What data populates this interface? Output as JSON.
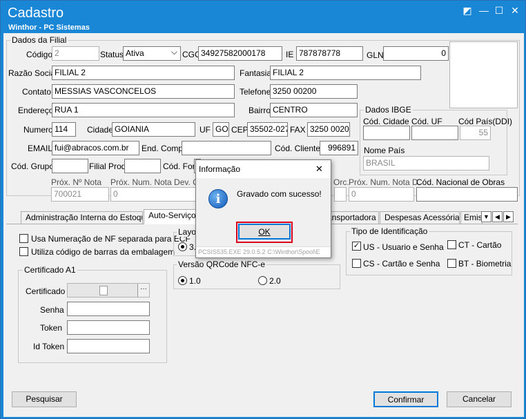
{
  "window": {
    "title": "Cadastro",
    "subtitle": "Winthor - PC Sistemas"
  },
  "dados_filial": {
    "group_title": "Dados da Filial",
    "codigo": {
      "label": "Código",
      "value": "2"
    },
    "status": {
      "label": "Status",
      "value": "Ativa"
    },
    "cgc": {
      "label": "CGC",
      "value": "34927582000178"
    },
    "ie": {
      "label": "IE",
      "value": "787878778"
    },
    "gln": {
      "label": "GLN",
      "value": "0"
    },
    "razao_social": {
      "label": "Razão Social",
      "value": "FILIAL 2"
    },
    "fantasia": {
      "label": "Fantasia",
      "value": "FILIAL 2"
    },
    "contato": {
      "label": "Contato",
      "value": "MESSIAS VASCONCELOS"
    },
    "telefone": {
      "label": "Telefone",
      "value": "3250 00200"
    },
    "endereco": {
      "label": "Endereço",
      "value": "RUA 1"
    },
    "bairro": {
      "label": "Bairro",
      "value": "CENTRO"
    },
    "numero": {
      "label": "Numero",
      "value": "114"
    },
    "cidade": {
      "label": "Cidade",
      "value": "GOIANIA"
    },
    "uf": {
      "label": "UF",
      "value": "GO"
    },
    "cep": {
      "label": "CEP",
      "value": "35502-027"
    },
    "fax": {
      "label": "FAX",
      "value": "3250 00200"
    },
    "email": {
      "label": "EMAIL",
      "value": "fui@abracos.com.br"
    },
    "end_comp": {
      "label": "End. Comp.",
      "value": ""
    },
    "cod_cliente": {
      "label": "Cód. Cliente",
      "value": "996891"
    },
    "cod_grupo": {
      "label": "Cód. Grupo",
      "value": ""
    },
    "filial_prod": {
      "label": "Filial Prod.",
      "value": ""
    },
    "cod_forn": {
      "label": "Cód. Forn",
      "value": ""
    },
    "prox_nota": {
      "label": "Próx. Nº Nota",
      "value": "700021"
    },
    "prox_nota_dev": {
      "label": "Próx. Num. Nota Dev. Cli.",
      "value": "0"
    },
    "prox_orc": {
      "label": "Orc.",
      "value": ""
    },
    "prox_nota_d": {
      "label": "Próx. Num. Nota D.",
      "value": "0"
    },
    "cod_nac_obras": {
      "label": "Cód. Nacional de Obras",
      "value": ""
    }
  },
  "dados_ibge": {
    "group_title": "Dados IBGE",
    "cod_cidade": {
      "label": "Cód. Cidade",
      "value": ""
    },
    "cod_uf": {
      "label": "Cód. UF",
      "value": ""
    },
    "cod_pais": {
      "label": "Cód País(DDI)",
      "value": "55"
    },
    "nome_pais": {
      "label": "Nome País",
      "value": "BRASIL"
    }
  },
  "tabs": [
    {
      "label": "Administração Interna do Estoque"
    },
    {
      "label": "Auto-Serviço"
    },
    {
      "label": "ansportadora"
    },
    {
      "label": "Despesas Acessórias"
    },
    {
      "label": "Emiss"
    }
  ],
  "auto_servico": {
    "usa_numeracao": "Usa Numeração de NF separada para ECF",
    "utiliza_codigo": "Utiliza código de barras da embalagem",
    "layout_title": "Layou",
    "layout_option": "3.",
    "versao_title": "Versão QRCode NFC-e",
    "versao_opt1": "1.0",
    "versao_opt2": "2.0",
    "tipo_ident_title": "Tipo de Identificação",
    "us_label": "US - Usuario e Senha",
    "ct_label": "CT - Cartão",
    "cs_label": "CS - Cartão e Senha",
    "bt_label": "BT - Biometria",
    "check_mark": "✓",
    "cert_title": "Certificado A1",
    "certificado_label": "Certificado",
    "cert_browse": "···",
    "senha_label": "Senha",
    "token_label": "Token",
    "idtoken_label": "Id Token"
  },
  "buttons": {
    "pesquisar": "Pesquisar",
    "confirmar": "Confirmar",
    "cancelar": "Cancelar"
  },
  "dialog": {
    "title": "Informação",
    "message": "Gravado com sucesso!",
    "ok": "OK",
    "info_glyph": "i",
    "close_glyph": "✕",
    "status": "PCSIS535.EXE 29.0.5.2 C:\\Winthor\\Spool\\E"
  },
  "icons": {
    "restore": "◩",
    "minimize": "—",
    "maximize": "☐",
    "close": "✕",
    "dropdown": "⌵",
    "tab_scroll": [
      "▼",
      "◀",
      "▶"
    ]
  }
}
